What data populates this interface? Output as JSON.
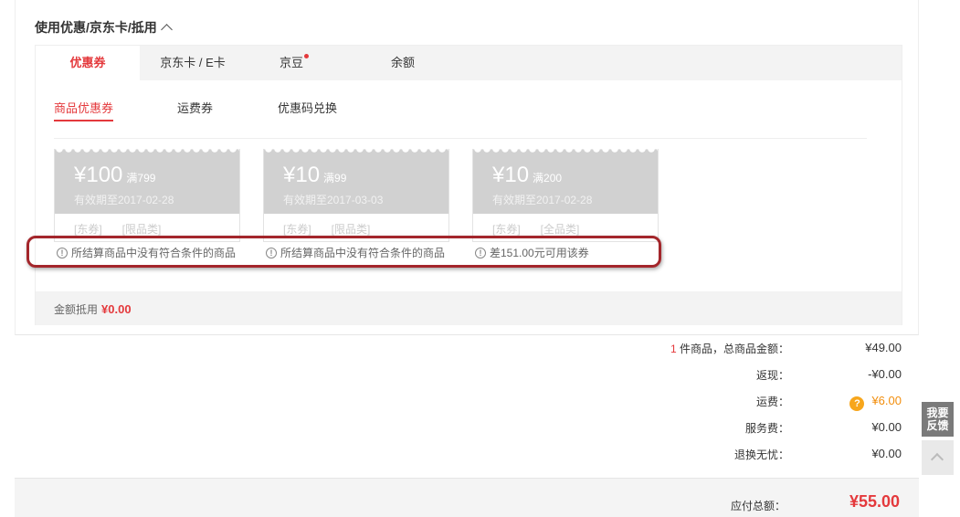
{
  "section": {
    "title": "使用优惠/京东卡/抵用"
  },
  "tabs": [
    {
      "label": "优惠券"
    },
    {
      "label": "京东卡 / E卡"
    },
    {
      "label": "京豆"
    },
    {
      "label": "余额"
    }
  ],
  "subtabs": [
    {
      "label": "商品优惠券"
    },
    {
      "label": "运费券"
    },
    {
      "label": "优惠码兑换"
    }
  ],
  "coupons": [
    {
      "amount": "¥100",
      "condition": "满799",
      "expiry": "有效期至2017-02-28",
      "tag1": "[东券]",
      "tag2": "[限品类]",
      "notice": "所结算商品中没有符合条件的商品"
    },
    {
      "amount": "¥10",
      "condition": "满99",
      "expiry": "有效期至2017-03-03",
      "tag1": "[东券]",
      "tag2": "[限品类]",
      "notice": "所结算商品中没有符合条件的商品"
    },
    {
      "amount": "¥10",
      "condition": "满200",
      "expiry": "有效期至2017-02-28",
      "tag1": "[东券]",
      "tag2": "[全品类]",
      "notice": "差151.00元可用该券"
    }
  ],
  "amount_bar": {
    "label": "金额抵用",
    "value": "¥0.00"
  },
  "summary": {
    "count": "1",
    "count_suffix": " 件商品，总商品金额：",
    "goods_total": "¥49.00",
    "rebate_label": "返现：",
    "rebate_value": "-¥0.00",
    "shipping_label": "运费：",
    "shipping_value": "¥6.00",
    "service_label": "服务费：",
    "service_value": "¥0.00",
    "return_label": "退换无忧：",
    "return_value": "¥0.00"
  },
  "total": {
    "label": "应付总额：",
    "value": "¥55.00"
  },
  "side": {
    "feedback_line1": "我要",
    "feedback_line2": "反馈"
  },
  "colors": {
    "accent": "#e4393c",
    "coupon_gray": "#d1d1d1",
    "highlight": "#a3262b",
    "shipping_orange": "#f28e0d"
  }
}
